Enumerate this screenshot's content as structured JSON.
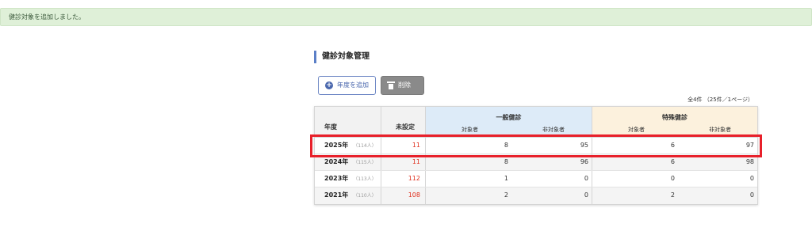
{
  "alert": {
    "message": "健診対象を追加しました。"
  },
  "section": {
    "title": "健診対象管理"
  },
  "toolbar": {
    "add_label": "年度を追加",
    "delete_label": "削除"
  },
  "pagination": {
    "summary": "全4件 （25件／1ページ）"
  },
  "table": {
    "headers": {
      "year": "年度",
      "unset": "未設定",
      "general": {
        "title": "一般健診",
        "target": "対象者",
        "non_target": "非対象者"
      },
      "special": {
        "title": "特殊健診",
        "target": "対象者",
        "non_target": "非対象者"
      }
    },
    "rows": [
      {
        "year": "2025年",
        "people": "（114人）",
        "unset": "11",
        "general_target": "8",
        "general_non": "95",
        "special_target": "6",
        "special_non": "97"
      },
      {
        "year": "2024年",
        "people": "（115人）",
        "unset": "11",
        "general_target": "8",
        "general_non": "96",
        "special_target": "6",
        "special_non": "98"
      },
      {
        "year": "2023年",
        "people": "（113人）",
        "unset": "112",
        "general_target": "1",
        "general_non": "0",
        "special_target": "0",
        "special_non": "0"
      },
      {
        "year": "2021年",
        "people": "（110人）",
        "unset": "108",
        "general_target": "2",
        "general_non": "0",
        "special_target": "2",
        "special_non": "0"
      }
    ]
  },
  "colors": {
    "accent": "#5b7fc7",
    "alert_bg": "#dff0d8",
    "unset_text": "#e0301e",
    "highlight": "#e8202a",
    "general_header": "#ddebf8",
    "special_header": "#fcf1dd"
  }
}
